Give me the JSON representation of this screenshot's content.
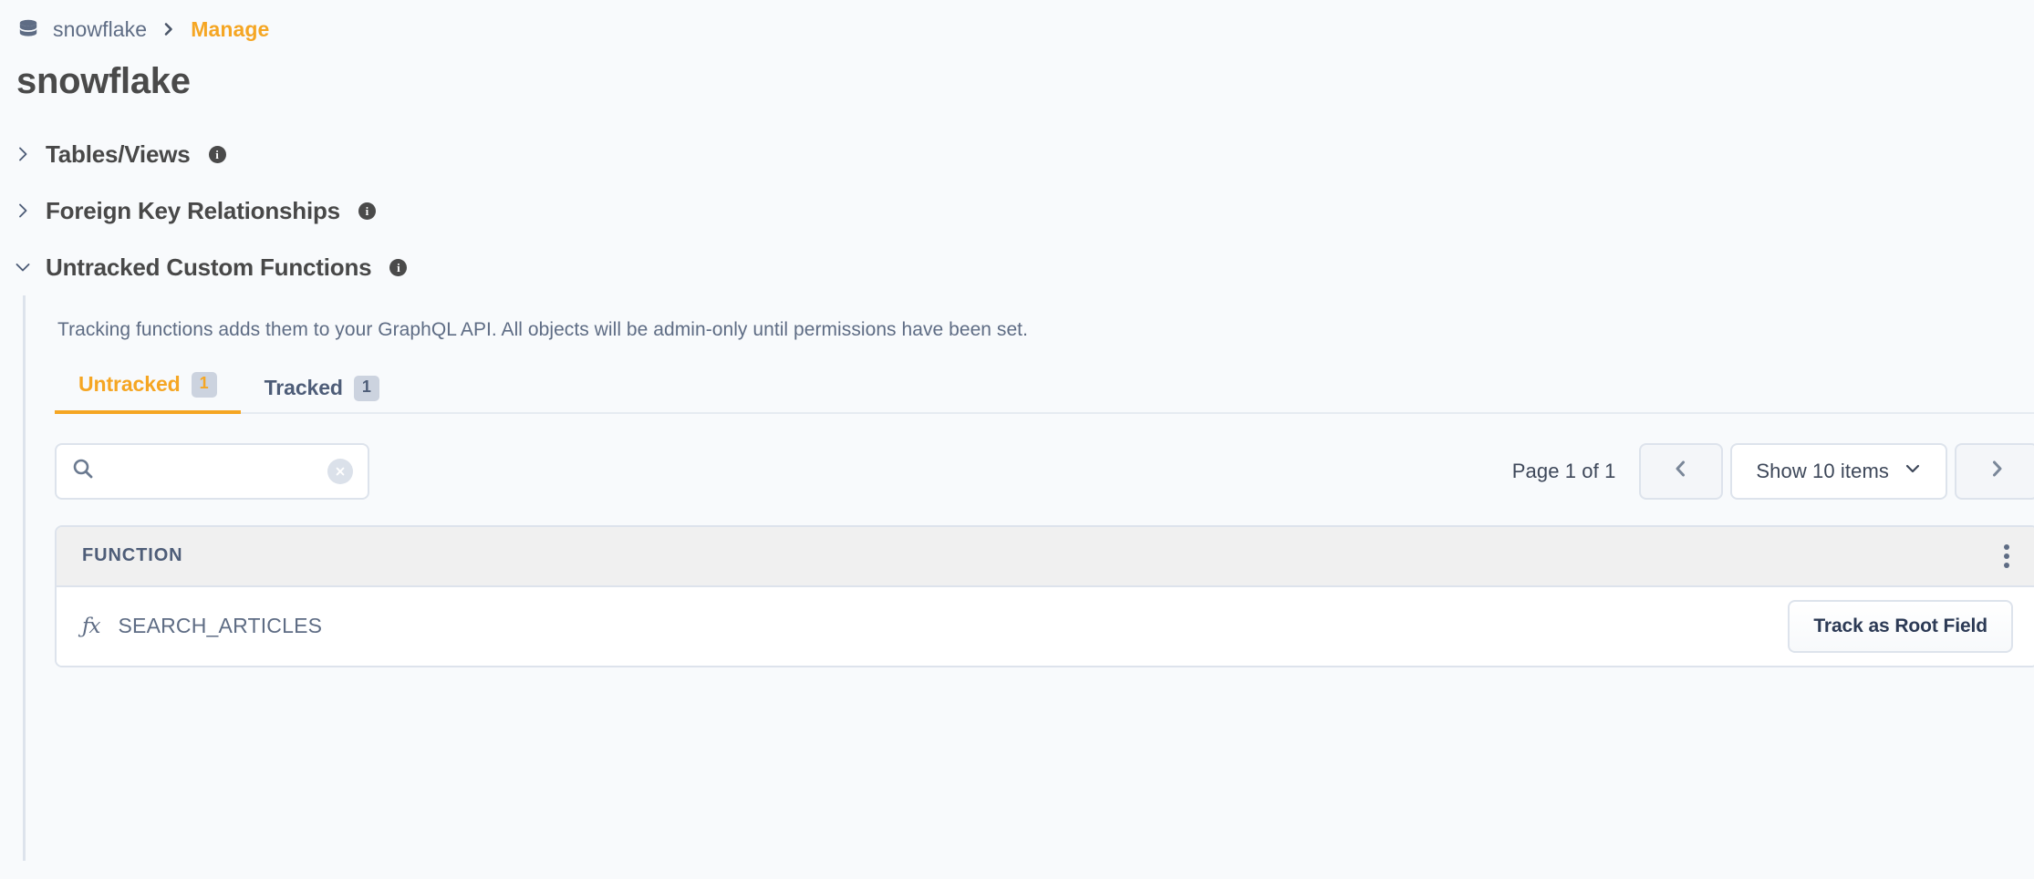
{
  "breadcrumb": {
    "db_icon": "database-icon",
    "db_label": "snowflake",
    "separator_icon": "chevron-right-icon",
    "current": "Manage"
  },
  "page_title": "snowflake",
  "sections": [
    {
      "label": "Tables/Views",
      "expanded": false,
      "info_icon": "info-icon"
    },
    {
      "label": "Foreign Key Relationships",
      "expanded": false,
      "info_icon": "info-icon"
    },
    {
      "label": "Untracked Custom Functions",
      "expanded": true,
      "info_icon": "info-icon"
    }
  ],
  "panel": {
    "description": "Tracking functions adds them to your GraphQL API. All objects will be admin-only until permissions have been set.",
    "tabs": [
      {
        "label": "Untracked",
        "badge": "1",
        "active": true
      },
      {
        "label": "Tracked",
        "badge": "1",
        "active": false
      }
    ],
    "search": {
      "value": "",
      "placeholder": "",
      "icon": "search-icon",
      "clear_icon": "close-circle-icon"
    },
    "pagination": {
      "page_label": "Page 1 of 1",
      "prev_icon": "chevron-left-icon",
      "next_icon": "chevron-right-icon",
      "page_size_label": "Show 10 items",
      "page_size_icon": "chevron-down-icon"
    },
    "table": {
      "columns": [
        "FUNCTION"
      ],
      "menu_icon": "kebab-menu-icon",
      "rows": [
        {
          "icon": "function-fx-icon",
          "name": "SEARCH_ARTICLES",
          "action": "Track as Root Field"
        }
      ]
    }
  },
  "colors": {
    "accent": "#f5a623",
    "slate": "#4e5d78",
    "muted": "#5e6c84",
    "border": "#dde3ec",
    "page_bg": "#f8fafc"
  }
}
